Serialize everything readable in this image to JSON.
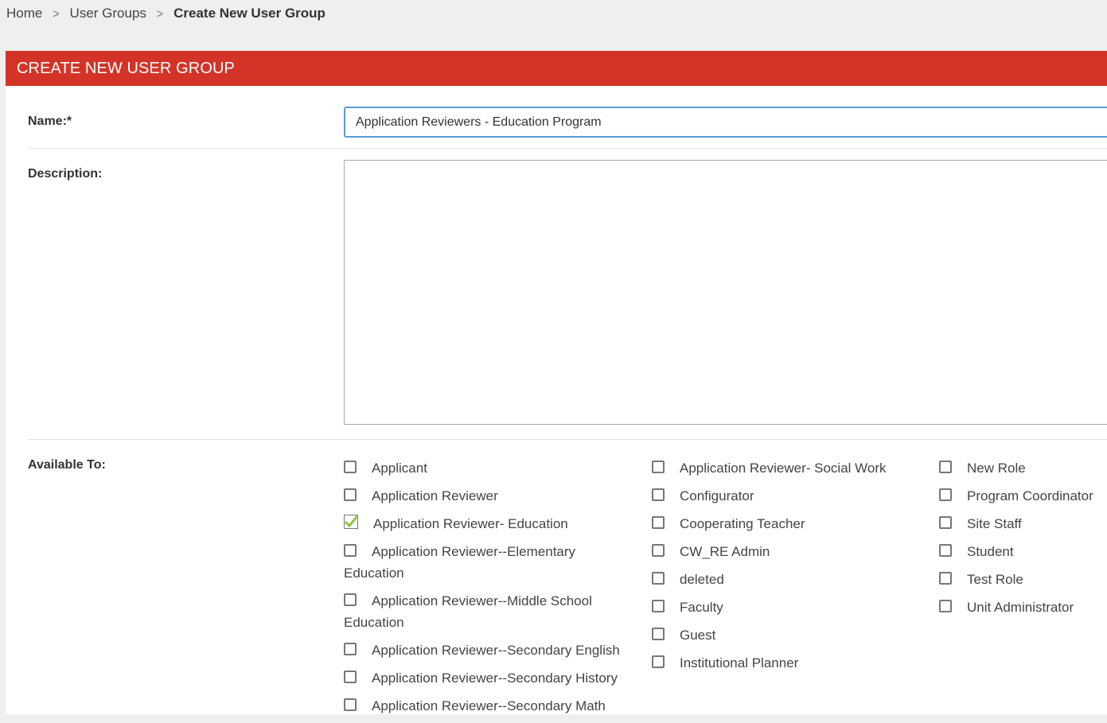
{
  "breadcrumb": {
    "home": "Home",
    "user_groups": "User Groups",
    "current": "Create New User Group",
    "separator": ">"
  },
  "panel": {
    "title": "CREATE NEW USER GROUP"
  },
  "form": {
    "name_label": "Name:*",
    "name_value": "Application Reviewers - Education Program",
    "description_label": "Description:",
    "description_value": "",
    "available_to_label": "Available To:"
  },
  "roles": {
    "column1": [
      {
        "label": "Applicant",
        "checked": false
      },
      {
        "label": "Application Reviewer",
        "checked": false
      },
      {
        "label": "Application Reviewer- Education",
        "checked": true
      },
      {
        "label": "Application Reviewer--Elementary Education",
        "checked": false
      },
      {
        "label": "Application Reviewer--Middle School Education",
        "checked": false
      },
      {
        "label": "Application Reviewer--Secondary English",
        "checked": false
      },
      {
        "label": "Application Reviewer--Secondary History",
        "checked": false
      },
      {
        "label": "Application Reviewer--Secondary Math",
        "checked": false
      }
    ],
    "column2": [
      {
        "label": "Application Reviewer- Social Work",
        "checked": false
      },
      {
        "label": "Configurator",
        "checked": false
      },
      {
        "label": "Cooperating Teacher",
        "checked": false
      },
      {
        "label": "CW_RE Admin",
        "checked": false
      },
      {
        "label": "deleted",
        "checked": false
      },
      {
        "label": "Faculty",
        "checked": false
      },
      {
        "label": "Guest",
        "checked": false
      },
      {
        "label": "Institutional Planner",
        "checked": false
      }
    ],
    "column3": [
      {
        "label": "New Role",
        "checked": false
      },
      {
        "label": "Program Coordinator",
        "checked": false
      },
      {
        "label": "Site Staff",
        "checked": false
      },
      {
        "label": "Student",
        "checked": false
      },
      {
        "label": "Test Role",
        "checked": false
      },
      {
        "label": "Unit Administrator",
        "checked": false
      }
    ]
  },
  "colors": {
    "header_bg": "#d33427",
    "checkmark": "#8cc63f",
    "input_focus_border": "#5b9bd5"
  }
}
